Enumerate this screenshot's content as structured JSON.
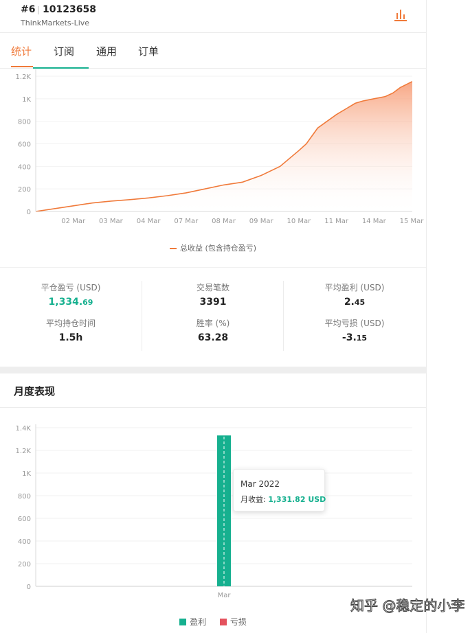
{
  "header": {
    "rank": "#6",
    "account": "10123658",
    "server": "ThinkMarkets-Live",
    "chart_icon": "bar-chart-icon"
  },
  "tabs": [
    {
      "label": "统计",
      "active": true
    },
    {
      "label": "订阅",
      "active": false
    },
    {
      "label": "通用",
      "active": false
    },
    {
      "label": "订单",
      "active": false
    }
  ],
  "colors": {
    "accent": "#f07a3a",
    "green": "#16b08f",
    "red": "#e4525e"
  },
  "profit_chart": {
    "legend": "总收益 (包含持仓盈亏)",
    "chart_data": {
      "type": "area",
      "x_tick_labels": [
        "02 Mar",
        "03 Mar",
        "04 Mar",
        "07 Mar",
        "08 Mar",
        "09 Mar",
        "10 Mar",
        "11 Mar",
        "14 Mar",
        "15 Mar"
      ],
      "y_tick_labels": [
        "0",
        "200",
        "400",
        "600",
        "800",
        "1K",
        "1.2K"
      ],
      "ylim": [
        0,
        1200
      ],
      "series": [
        {
          "name": "总收益 (包含持仓盈亏)",
          "x": [
            0,
            0.5,
            1,
            1.5,
            2,
            2.5,
            3,
            3.5,
            4,
            4.5,
            5,
            5.5,
            6,
            6.5,
            7,
            7.2,
            7.5,
            8,
            8.3,
            8.5,
            8.7,
            9,
            9.3,
            9.5,
            9.7,
            10,
            10.3,
            10.5,
            11,
            11.5
          ],
          "y": [
            0,
            25,
            50,
            75,
            92,
            105,
            120,
            140,
            165,
            200,
            235,
            260,
            320,
            400,
            540,
            600,
            740,
            860,
            920,
            960,
            980,
            1000,
            1020,
            1050,
            1100,
            1150,
            1180,
            1200,
            1250,
            1300
          ]
        }
      ]
    }
  },
  "stats": {
    "closed_pnl": {
      "label": "平仓盈亏 (USD)",
      "int": "1,334.",
      "dec": "69"
    },
    "trades": {
      "label": "交易笔数",
      "value": "3391"
    },
    "avg_profit": {
      "label": "平均盈利 (USD)",
      "int": "2.",
      "dec": "45"
    },
    "avg_hold": {
      "label": "平均持仓时间",
      "value": "1.5h"
    },
    "win_rate": {
      "label": "胜率 (%)",
      "value": "63.28"
    },
    "avg_loss": {
      "label": "平均亏损 (USD)",
      "int": "-3.",
      "dec": "15"
    }
  },
  "monthly": {
    "title": "月度表现",
    "tooltip": {
      "date": "Mar 2022",
      "label": "月收益: ",
      "value": "1,331.82 USD"
    },
    "legend": [
      {
        "name": "盈利",
        "color": "#16b08f"
      },
      {
        "name": "亏损",
        "color": "#e4525e"
      }
    ],
    "chart_data": {
      "type": "bar",
      "categories": [
        "Mar"
      ],
      "series": [
        {
          "name": "盈利",
          "values": [
            1331.82
          ]
        },
        {
          "name": "亏损",
          "values": [
            0
          ]
        }
      ],
      "y_tick_labels": [
        "0",
        "200",
        "400",
        "600",
        "800",
        "1K",
        "1.2K",
        "1.4K"
      ],
      "ylim": [
        0,
        1400
      ]
    }
  },
  "watermark": "知乎 @稳定的小李"
}
